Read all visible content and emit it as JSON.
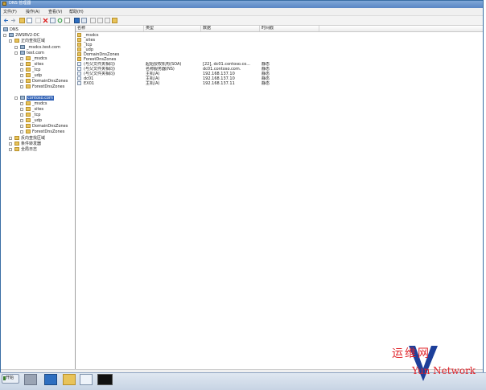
{
  "window": {
    "title": "DNS 管理器"
  },
  "menu": [
    {
      "label": "文件(F)"
    },
    {
      "label": "操作(A)"
    },
    {
      "label": "查看(V)"
    },
    {
      "label": "帮助(H)"
    }
  ],
  "tree": {
    "root": "DNS",
    "server": "2WSRV2-DC",
    "forward_zones": "正向查找区域",
    "zone1": "_msdcs.test.com",
    "zone2": "test.com",
    "zone2_children": [
      "_msdcs",
      "_sites",
      "_tcp",
      "_udp",
      "DomainDnsZones",
      "ForestDnsZones"
    ],
    "zone3": "contoso.com",
    "zone3_children": [
      "_msdcs",
      "_sites",
      "_tcp",
      "_udp",
      "DomainDnsZones",
      "ForestDnsZones"
    ],
    "reverse_zones": "反向查找区域",
    "conditional": "条件转发器",
    "global_logs": "全局日志"
  },
  "list": {
    "columns": [
      "名称",
      "类型",
      "数据",
      "时间戳"
    ],
    "rows": [
      {
        "icon": "folder",
        "name": "_msdcs",
        "type": "",
        "data": "",
        "time": ""
      },
      {
        "icon": "folder",
        "name": "_sites",
        "type": "",
        "data": "",
        "time": ""
      },
      {
        "icon": "folder",
        "name": "_tcp",
        "type": "",
        "data": "",
        "time": ""
      },
      {
        "icon": "folder",
        "name": "_udp",
        "type": "",
        "data": "",
        "time": ""
      },
      {
        "icon": "folder",
        "name": "DomainDnsZones",
        "type": "",
        "data": "",
        "time": ""
      },
      {
        "icon": "folder",
        "name": "ForestDnsZones",
        "type": "",
        "data": "",
        "time": ""
      },
      {
        "icon": "record",
        "name": "(与父文件夹相同)",
        "type": "起始授权机构(SOA)",
        "data": "[22], dc01.contoso.co...",
        "time": "静态"
      },
      {
        "icon": "record",
        "name": "(与父文件夹相同)",
        "type": "名称服务器(NS)",
        "data": "dc01.contoso.com.",
        "time": "静态"
      },
      {
        "icon": "record",
        "name": "(与父文件夹相同)",
        "type": "主机(A)",
        "data": "192.168.137.10",
        "time": "静态"
      },
      {
        "icon": "record",
        "name": "dc01",
        "type": "主机(A)",
        "data": "192.168.137.10",
        "time": "静态"
      },
      {
        "icon": "record",
        "name": "EX01",
        "type": "主机(A)",
        "data": "192.168.137.11",
        "time": "静态"
      }
    ]
  },
  "taskbar": {
    "start_label": "开始"
  },
  "watermark": {
    "line1": "运维网",
    "line2": "Yun Network"
  },
  "colors": {
    "selection": "#3162b6",
    "titlebar": "#5a86c4",
    "watermark": "#e0242a"
  }
}
